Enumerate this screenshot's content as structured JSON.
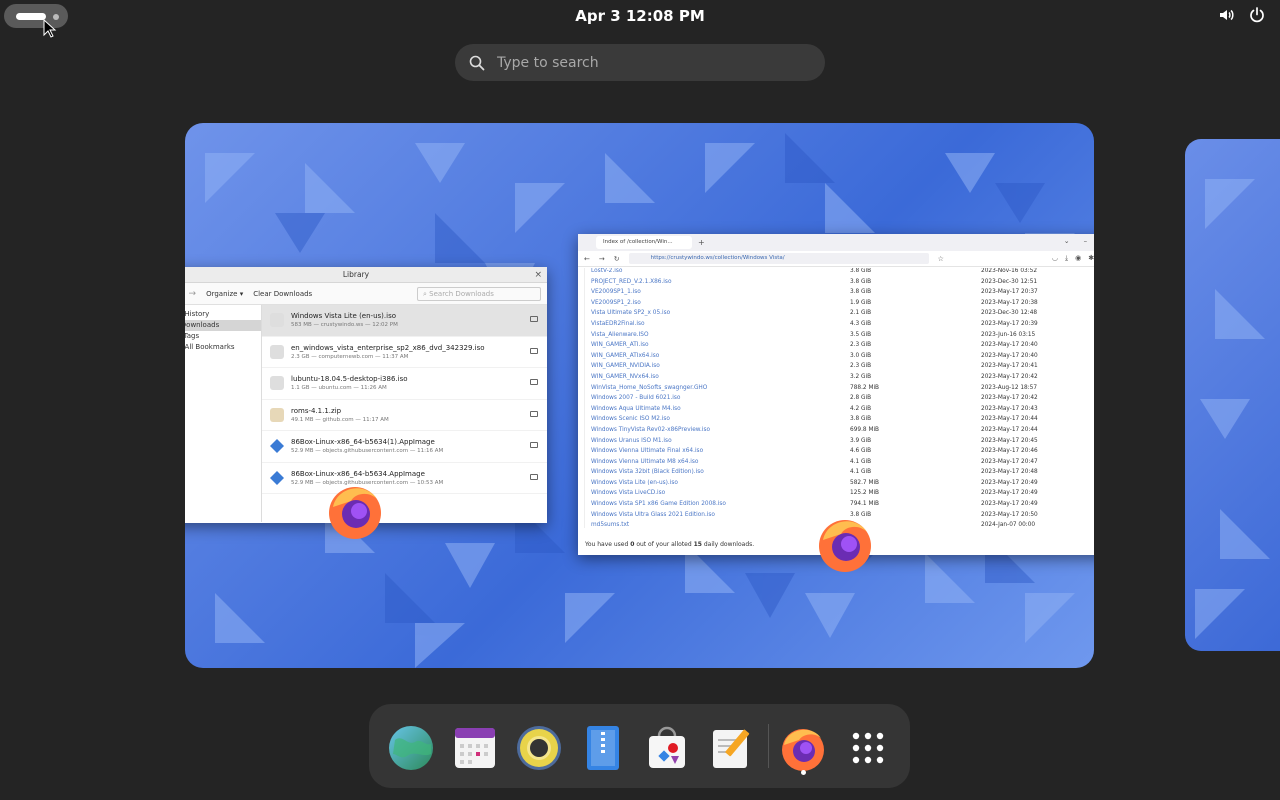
{
  "topbar": {
    "clock": "Apr 3  12:08 PM"
  },
  "search": {
    "placeholder": "Type to search"
  },
  "library": {
    "title": "Library",
    "organize_label": "Organize",
    "clear_label": "Clear Downloads",
    "search_placeholder": "Search Downloads",
    "sidebar": [
      "History",
      "Downloads",
      "Tags",
      "All Bookmarks"
    ],
    "downloads": [
      {
        "name": "Windows Vista Lite (en-us).iso",
        "meta": "583 MB — crustywindo.ws — 12:02 PM"
      },
      {
        "name": "en_windows_vista_enterprise_sp2_x86_dvd_342329.iso",
        "meta": "2.3 GB — computernewb.com — 11:37 AM"
      },
      {
        "name": "lubuntu-18.04.5-desktop-i386.iso",
        "meta": "1.1 GB — ubuntu.com — 11:26 AM"
      },
      {
        "name": "roms-4.1.1.zip",
        "meta": "49.1 MB — github.com — 11:17 AM"
      },
      {
        "name": "86Box-Linux-x86_64-b5634(1).AppImage",
        "meta": "52.9 MB — objects.githubusercontent.com — 11:16 AM"
      },
      {
        "name": "86Box-Linux-x86_64-b5634.AppImage",
        "meta": "52.9 MB — objects.githubusercontent.com — 10:53 AM"
      }
    ]
  },
  "firefox": {
    "tab_title": "Index of /collection/Win...",
    "url": "https://crustywindo.ws/collection/Windows Vista/",
    "files": [
      {
        "name": "LostV-2.iso",
        "size": "3.8 GiB",
        "date": "2023-Nov-16 03:52"
      },
      {
        "name": "PROJECT_RED_V.2.1.X86.iso",
        "size": "3.8 GiB",
        "date": "2023-Dec-30 12:51"
      },
      {
        "name": "VE2009SP1_1.iso",
        "size": "3.8 GiB",
        "date": "2023-May-17 20:37"
      },
      {
        "name": "VE2009SP1_2.iso",
        "size": "1.9 GiB",
        "date": "2023-May-17 20:38"
      },
      {
        "name": "Vista Ultimate SP2_x 05.iso",
        "size": "2.1 GiB",
        "date": "2023-Dec-30 12:48"
      },
      {
        "name": "VistaEDR2Final.iso",
        "size": "4.3 GiB",
        "date": "2023-May-17 20:39"
      },
      {
        "name": "Vista_Alienware.ISO",
        "size": "3.5 GiB",
        "date": "2023-Jun-16 03:15"
      },
      {
        "name": "WIN_GAMER_ATI.iso",
        "size": "2.3 GiB",
        "date": "2023-May-17 20:40"
      },
      {
        "name": "WIN_GAMER_ATIx64.iso",
        "size": "3.0 GiB",
        "date": "2023-May-17 20:40"
      },
      {
        "name": "WIN_GAMER_NVIDIA.iso",
        "size": "2.3 GiB",
        "date": "2023-May-17 20:41"
      },
      {
        "name": "WIN_GAMER_NVx64.iso",
        "size": "3.2 GiB",
        "date": "2023-May-17 20:42"
      },
      {
        "name": "WinVista_Home_NoSofts_swagnger.GHO",
        "size": "788.2 MiB",
        "date": "2023-Aug-12 18:57"
      },
      {
        "name": "Windows 2007 - Build 6021.iso",
        "size": "2.8 GiB",
        "date": "2023-May-17 20:42"
      },
      {
        "name": "Windows Aqua Ultimate M4.iso",
        "size": "4.2 GiB",
        "date": "2023-May-17 20:43"
      },
      {
        "name": "Windows Scenic ISO M2.iso",
        "size": "3.8 GiB",
        "date": "2023-May-17 20:44"
      },
      {
        "name": "Windows TinyVista Rev02-x86Preview.iso",
        "size": "699.8 MiB",
        "date": "2023-May-17 20:44"
      },
      {
        "name": "Windows Uranus ISO M1.iso",
        "size": "3.9 GiB",
        "date": "2023-May-17 20:45"
      },
      {
        "name": "Windows Vienna Ultimate Final x64.iso",
        "size": "4.6 GiB",
        "date": "2023-May-17 20:46"
      },
      {
        "name": "Windows Vienna Ultimate M8 x64.iso",
        "size": "4.1 GiB",
        "date": "2023-May-17 20:47"
      },
      {
        "name": "Windows Vista 32bit (Black Edition).iso",
        "size": "4.1 GiB",
        "date": "2023-May-17 20:48"
      },
      {
        "name": "Windows Vista Lite (en-us).iso",
        "size": "582.7 MiB",
        "date": "2023-May-17 20:49"
      },
      {
        "name": "Windows Vista LiveCD.iso",
        "size": "125.2 MiB",
        "date": "2023-May-17 20:49"
      },
      {
        "name": "Windows Vista SP1 x86 Game Edition 2008.iso",
        "size": "794.1 MiB",
        "date": "2023-May-17 20:49"
      },
      {
        "name": "Windows Vista Ultra Glass 2021 Edition.iso",
        "size": "3.8 GiB",
        "date": "2023-May-17 20:50"
      },
      {
        "name": "md5sums.txt",
        "size": "",
        "date": "2024-Jan-07 00:00"
      }
    ],
    "footer_prefix": "You have used ",
    "footer_used": "0",
    "footer_mid": " out of your alloted ",
    "footer_total": "15",
    "footer_suffix": " daily downloads."
  },
  "dock": {
    "apps": [
      "web-browser",
      "calendar",
      "rhythmbox",
      "text-files",
      "software-center",
      "text-editor",
      "firefox",
      "app-grid"
    ]
  }
}
